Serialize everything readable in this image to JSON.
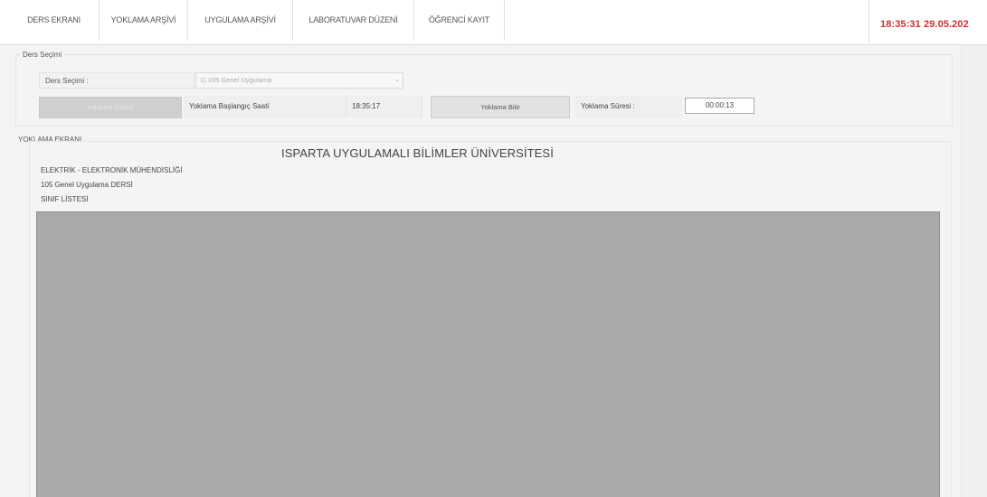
{
  "menu": {
    "items": [
      "DERS EKRANI",
      "YOKLAMA ARŞİVİ",
      "UYGULAMA ARŞİVİ",
      "LABORATUVAR DÜZENİ",
      "ÖĞRENCİ KAYIT"
    ],
    "clock": "18:35:31  29.05.202"
  },
  "ders_secimi": {
    "legend": "Ders Seçimi",
    "label": "Ders Seçimi :",
    "combo_value": "1) 105 Genel Uygulama",
    "start_button": "Yoklama Başlat",
    "start_time_label": "Yoklama Başlangıç Saati",
    "start_time_value": "18:35:17",
    "finish_button": "Yoklama Bitir",
    "duration_label": "Yoklama Süresi :",
    "duration_value": "00:00:13"
  },
  "yoklama": {
    "section_label": "YOKLAMA EKRANI",
    "university": "ISPARTA UYGULAMALI BİLİMLER ÜNİVERSİTESİ",
    "department": "ELEKTRİK - ELEKTRONİK MÜHENDİSLİĞİ",
    "course": "105   Genel Uygulama DERSİ",
    "list_title": "SINIF LİSTESİ"
  },
  "colors": {
    "clock": "#d03030",
    "grid_background": "#a9a9a9"
  }
}
